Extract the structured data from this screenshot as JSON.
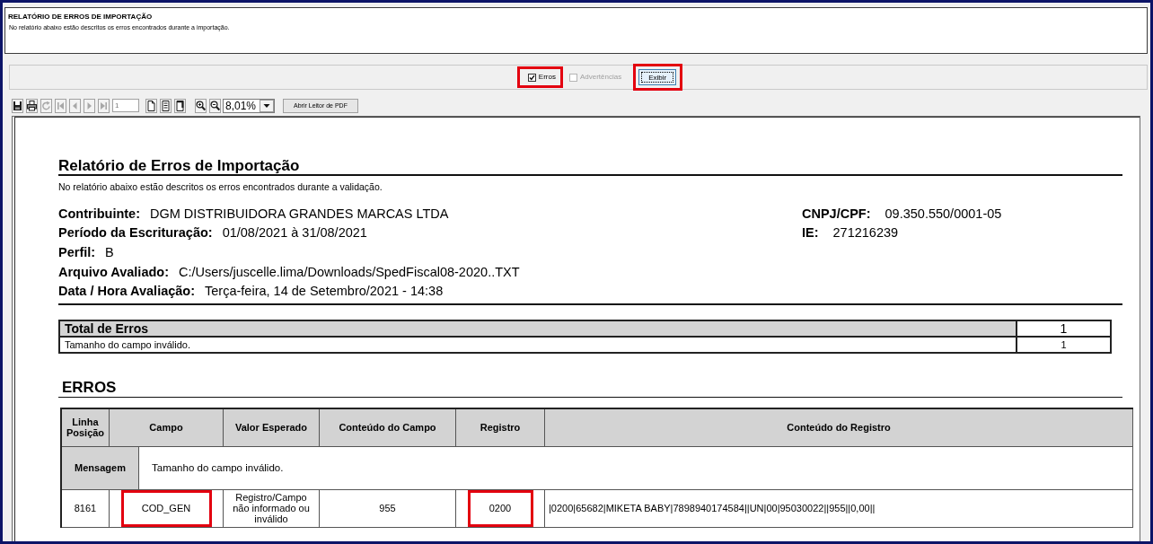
{
  "header": {
    "title": "RELATÓRIO DE ERROS DE IMPORTAÇÃO",
    "description": "No relatório abaixo estão descritos os erros encontrados durante a importação."
  },
  "filters": {
    "checkboxes": [
      {
        "label": "Erros",
        "checked": true,
        "disabled": false,
        "highlighted": true
      },
      {
        "label": "Advertências",
        "checked": false,
        "disabled": true,
        "highlighted": false
      }
    ],
    "show_button": {
      "label": "Exibir",
      "focused": true,
      "highlighted": true
    }
  },
  "toolbar": {
    "nav_tools": [
      {
        "kind": "save",
        "disabled": false
      },
      {
        "kind": "print",
        "disabled": false
      },
      {
        "kind": "refresh",
        "disabled": true
      },
      {
        "kind": "first",
        "disabled": true
      },
      {
        "kind": "previous",
        "disabled": true
      },
      {
        "kind": "next",
        "disabled": true
      },
      {
        "kind": "last",
        "disabled": true
      }
    ],
    "page_field": {
      "value": "1"
    },
    "view_tools": [
      {
        "kind": "single-page"
      },
      {
        "kind": "full-page"
      },
      {
        "kind": "page-width"
      }
    ],
    "zoom_tools": [
      {
        "kind": "zoom-in"
      },
      {
        "kind": "zoom-out"
      }
    ],
    "zoom_select": {
      "value": "8,01%"
    },
    "pdf_button": {
      "label": "Abrir Leitor de PDF"
    }
  },
  "report": {
    "title": "Relatório de Erros de Importação",
    "description": "No relatório abaixo estão descritos os erros encontrados durante a validação.",
    "fields": [
      {
        "label": "Contribuinte:",
        "value": "DGM DISTRIBUIDORA GRANDES MARCAS LTDA"
      },
      {
        "label": "Período da Escrituração:",
        "value": "01/08/2021 à 31/08/2021"
      },
      {
        "label": "Perfil:",
        "value": "B"
      },
      {
        "label": "Arquivo Avaliado:",
        "value": "C:/Users/juscelle.lima/Downloads/SpedFiscal08-2020..TXT"
      },
      {
        "label": "Data / Hora Avaliação:",
        "value": "Terça-feira, 14 de Setembro/2021 - 14:38"
      }
    ],
    "side_fields": [
      {
        "label": "CNPJ/CPF:",
        "value": "09.350.550/0001-05"
      },
      {
        "label": "IE:",
        "value": "271216239"
      }
    ],
    "totals": {
      "title": "Total de Erros",
      "total": "1",
      "rows": [
        {
          "message": "Tamanho do campo inválido.",
          "count": "1"
        }
      ]
    },
    "errors": {
      "title": "ERROS",
      "columns": [
        "Linha Posição",
        "Campo",
        "Valor Esperado",
        "Conteúdo do Campo",
        "Registro",
        "Conteúdo do Registro"
      ],
      "groups": [
        {
          "message_label": "Mensagem",
          "message": "Tamanho do campo inválido.",
          "rows": [
            {
              "cells": [
                {
                  "text": "8161",
                  "highlighted": false
                },
                {
                  "text": "COD_GEN",
                  "highlighted": true
                },
                {
                  "text": "Registro/Campo não informado ou inválido",
                  "highlighted": false
                },
                {
                  "text": "955",
                  "highlighted": false
                },
                {
                  "text": "0200",
                  "highlighted": true
                },
                {
                  "text": "|0200|65682|MIKETA BABY|7898940174584||UN|00|95030022||955||0,00||",
                  "highlighted": false
                }
              ]
            }
          ]
        }
      ]
    }
  }
}
